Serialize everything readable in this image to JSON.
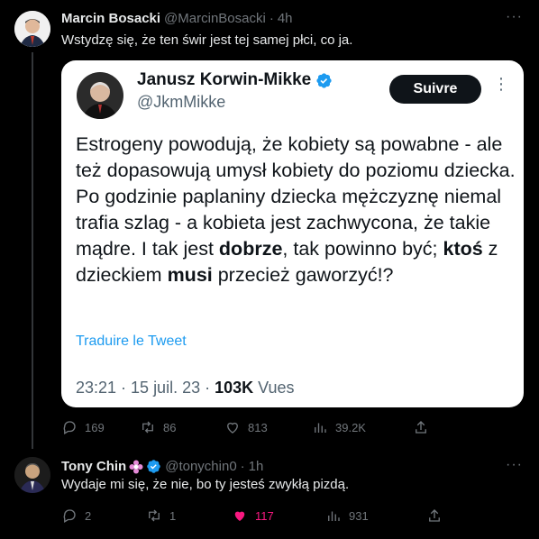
{
  "tweet1": {
    "name": "Marcin Bosacki",
    "handle": "@MarcinBosacki",
    "time": "4h",
    "text": "Wstydzę się, że ten świr jest tej samej płci, co ja.",
    "quoted": {
      "name": "Janusz Korwin-Mikke",
      "handle": "@JkmMikke",
      "follow_label": "Suivre",
      "body_part1": "Estrogeny powodują, że kobiety są powabne - ale też dopasowują umysł kobiety do poziomu dziecka. Po godzinie paplaniny dziecka mężczyznę niemal trafia szlag - a kobieta jest zachwycona, że takie mądre. I tak jest ",
      "body_bold1": "dobrze",
      "body_part2": ", tak powinno być; ",
      "body_bold2": "ktoś",
      "body_part3": " z dzieckiem ",
      "body_bold3": "musi",
      "body_part4": " przecież gaworzyć!?",
      "translate_label": "Traduire le Tweet",
      "meta_time": "23:21 · 15 juil. 23 · ",
      "meta_views_count": "103K",
      "meta_views_label": " Vues"
    },
    "stats": {
      "replies": "169",
      "retweets": "86",
      "likes": "813",
      "views": "39.2K"
    }
  },
  "tweet2": {
    "name": "Tony Chin",
    "handle": "@tonychin0",
    "time": "1h",
    "text": "Wydaje mi się, że nie, bo ty jesteś zwykłą pizdą.",
    "stats": {
      "replies": "2",
      "retweets": "1",
      "likes": "117",
      "views": "931"
    }
  },
  "colors": {
    "accent": "#1d9bf0",
    "like": "#f91880",
    "muted": "#71767b"
  }
}
